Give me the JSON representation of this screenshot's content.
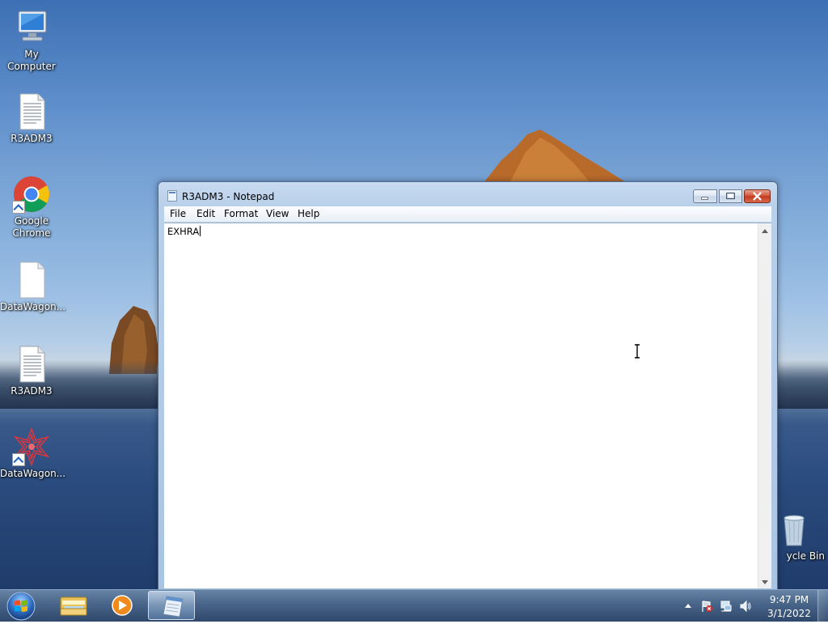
{
  "desktop": {
    "icons": [
      {
        "label": "My Computer"
      },
      {
        "label": "R3ADM3"
      },
      {
        "label": "Google Chrome"
      },
      {
        "label": "DataWagon..."
      },
      {
        "label": "R3ADM3"
      },
      {
        "label": "DataWagon..."
      },
      {
        "label": "ycle Bin"
      }
    ]
  },
  "notepad": {
    "title": "R3ADM3 - Notepad",
    "menu": [
      "File",
      "Edit",
      "Format",
      "View",
      "Help"
    ],
    "content": "EXHRA"
  },
  "taskbar": {
    "clock_time": "9:47 PM",
    "clock_date": "3/1/2022"
  },
  "colors": {
    "accent": "#3d6fb4",
    "close_button": "#c23a1e"
  }
}
